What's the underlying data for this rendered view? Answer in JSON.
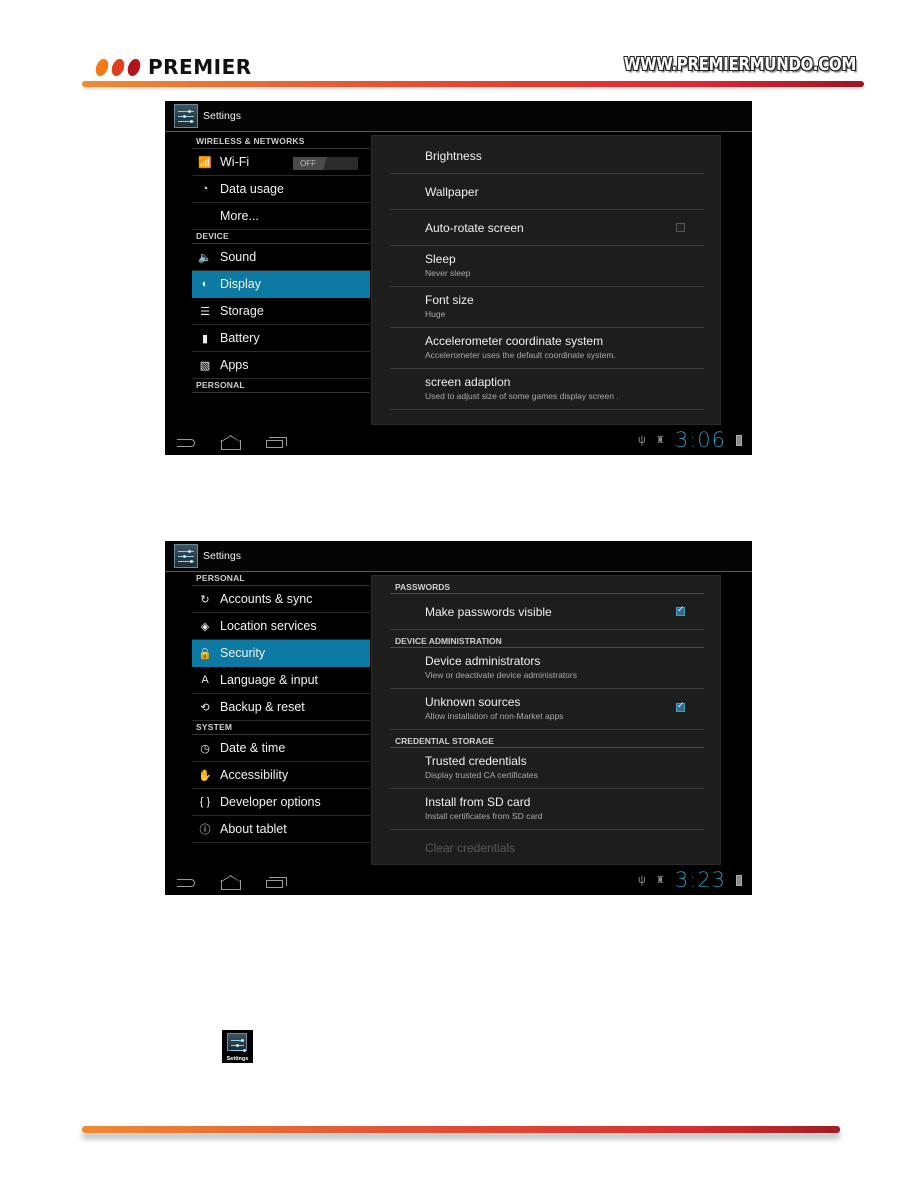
{
  "header": {
    "brand": "PREMIER",
    "website": "WWW.PREMIERMUNDO.COM",
    "brand_colors": [
      "#f07a1c",
      "#e0401c",
      "#b3141c"
    ]
  },
  "screens": [
    {
      "action_bar_title": "Settings",
      "left_list": [
        {
          "type": "header",
          "label": "WIRELESS & NETWORKS"
        },
        {
          "type": "item",
          "icon": "wifi-icon",
          "label": "Wi-Fi",
          "toggle": "OFF"
        },
        {
          "type": "item",
          "icon": "data-usage-icon",
          "label": "Data usage"
        },
        {
          "type": "item",
          "icon": "",
          "label": "More..."
        },
        {
          "type": "header",
          "label": "DEVICE"
        },
        {
          "type": "item",
          "icon": "sound-icon",
          "label": "Sound"
        },
        {
          "type": "item",
          "icon": "display-icon",
          "label": "Display",
          "selected": true
        },
        {
          "type": "item",
          "icon": "storage-icon",
          "label": "Storage"
        },
        {
          "type": "item",
          "icon": "battery-icon",
          "label": "Battery"
        },
        {
          "type": "item",
          "icon": "apps-icon",
          "label": "Apps"
        },
        {
          "type": "header",
          "label": "PERSONAL"
        }
      ],
      "right_panel": [
        {
          "title": "Brightness"
        },
        {
          "title": "Wallpaper"
        },
        {
          "title": "Auto-rotate screen",
          "checkbox": false
        },
        {
          "title": "Sleep",
          "summary": "Never sleep"
        },
        {
          "title": "Font size",
          "summary": "Huge"
        },
        {
          "title": "Accelerometer coordinate system",
          "summary": "Accelerometer uses the default coordinate system."
        },
        {
          "title": "screen adaption",
          "summary": "Used to adjust size of some games display screen ."
        }
      ],
      "clock": "3:06"
    },
    {
      "action_bar_title": "Settings",
      "left_list": [
        {
          "type": "header",
          "label": "PERSONAL"
        },
        {
          "type": "item",
          "icon": "sync-icon",
          "label": "Accounts & sync"
        },
        {
          "type": "item",
          "icon": "location-icon",
          "label": "Location services"
        },
        {
          "type": "item",
          "icon": "lock-icon",
          "label": "Security",
          "selected": true
        },
        {
          "type": "item",
          "icon": "language-icon",
          "label": "Language & input"
        },
        {
          "type": "item",
          "icon": "backup-icon",
          "label": "Backup & reset"
        },
        {
          "type": "header",
          "label": "SYSTEM"
        },
        {
          "type": "item",
          "icon": "clock-icon",
          "label": "Date & time"
        },
        {
          "type": "item",
          "icon": "accessibility-icon",
          "label": "Accessibility"
        },
        {
          "type": "item",
          "icon": "developer-icon",
          "label": "Developer options"
        },
        {
          "type": "item",
          "icon": "info-icon",
          "label": "About tablet"
        }
      ],
      "right_panel": [
        {
          "category": "PASSWORDS"
        },
        {
          "title": "Make passwords visible",
          "checkbox": true
        },
        {
          "category": "DEVICE ADMINISTRATION"
        },
        {
          "title": "Device administrators",
          "summary": "View or deactivate device administrators"
        },
        {
          "title": "Unknown sources",
          "summary": "Allow installation of non-Market apps",
          "checkbox": true
        },
        {
          "category": "CREDENTIAL STORAGE"
        },
        {
          "title": "Trusted credentials",
          "summary": "Display trusted CA certificates"
        },
        {
          "title": "Install from SD card",
          "summary": "Install certificates from SD card"
        },
        {
          "title": "Clear credentials",
          "disabled": true
        }
      ],
      "clock": "3:23"
    }
  ],
  "mini_icon": {
    "caption": "Settings"
  },
  "icon_glyphs": {
    "wifi-icon": "📶",
    "data-usage-icon": "◔",
    "sound-icon": "🔈",
    "display-icon": "◐",
    "storage-icon": "☰",
    "battery-icon": "▮",
    "apps-icon": "▧",
    "sync-icon": "↻",
    "location-icon": "◈",
    "lock-icon": "🔒",
    "language-icon": "A",
    "backup-icon": "⟲",
    "clock-icon": "◷",
    "accessibility-icon": "✋",
    "developer-icon": "{ }",
    "info-icon": "ⓘ",
    "usb-icon": "ψ",
    "android-icon": "♜"
  }
}
